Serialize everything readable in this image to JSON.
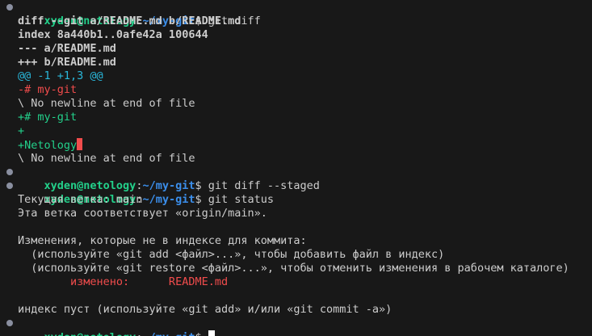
{
  "colors": {
    "background": "#181818",
    "foreground": "#cccccc",
    "prompt_user": "#23d18b",
    "prompt_path": "#3b8eea",
    "hunk_header": "#29b8db",
    "removed": "#f14c4c",
    "added": "#23d18b",
    "trailing_whitespace": "#f14c4c",
    "prompt_dot": "#8a8fa0"
  },
  "prompt": {
    "user_host": "xyden@netology",
    "separator": ":",
    "path": "~/my-git",
    "symbol": "$ "
  },
  "lines": {
    "cmd1": "git diff",
    "diff_header": "diff --git a/README.md b/README.md",
    "index_line": "index 8a440b1..0afe42a 100644",
    "minus_file": "--- a/README.md",
    "plus_file": "+++ b/README.md",
    "hunk": "@@ -1 +1,3 @@",
    "removed_line": "-# my-git",
    "no_newline_1": "\\ No newline at end of file",
    "added_line_1": "+# my-git",
    "added_line_2": "+",
    "added_line_3": "+Netology",
    "no_newline_2": "\\ No newline at end of file",
    "cmd2": "git diff --staged",
    "cmd3": "git status",
    "branch": "Текущая ветка: main",
    "branch_sync": "Эта ветка соответствует «origin/main».",
    "changes_header": "Изменения, которые не в индексе для коммита:",
    "hint_add": "  (используйте «git add <файл>...», чтобы добавить файл в индекс)",
    "hint_restore": "  (используйте «git restore <файл>...», чтобы отменить изменения в рабочем каталоге)",
    "modified_label": "        изменено:      README.md",
    "index_empty": "индекс пуст (используйте «git add» и/или «git commit -a»)"
  }
}
